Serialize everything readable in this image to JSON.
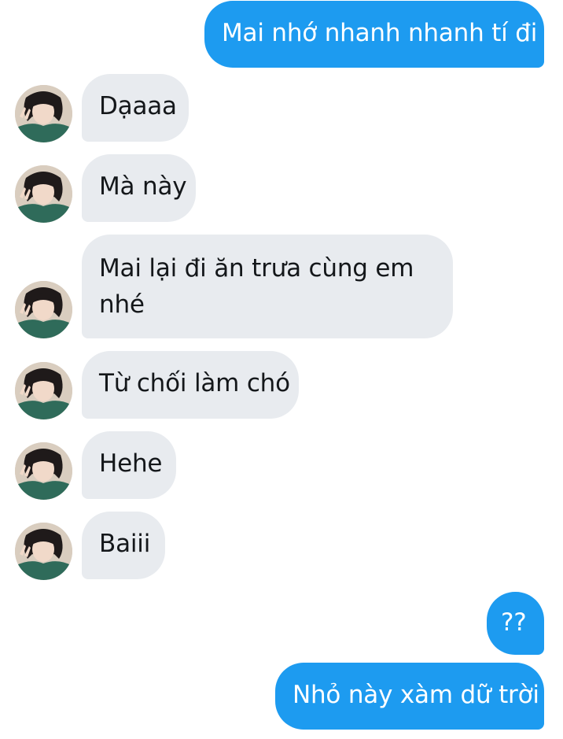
{
  "messages": [
    {
      "sender": "me",
      "text": "Mai nhớ nhanh nhanh tí đi"
    },
    {
      "sender": "other",
      "text": "Dạaaa"
    },
    {
      "sender": "other",
      "text": "Mà này"
    },
    {
      "sender": "other",
      "text": "Mai lại đi ăn trưa cùng em nhé"
    },
    {
      "sender": "other",
      "text": "Từ chối làm chó"
    },
    {
      "sender": "other",
      "text": "Hehe"
    },
    {
      "sender": "other",
      "text": "Baiii"
    },
    {
      "sender": "me",
      "text": "??"
    },
    {
      "sender": "me",
      "text": "Nhỏ này xàm dữ trời"
    }
  ],
  "colors": {
    "outgoing_bubble": "#1d9bf0",
    "incoming_bubble": "#e8ebef",
    "incoming_text": "#14171a",
    "outgoing_text": "#ffffff"
  },
  "icons": {
    "avatar": "profile-photo-avatar"
  }
}
